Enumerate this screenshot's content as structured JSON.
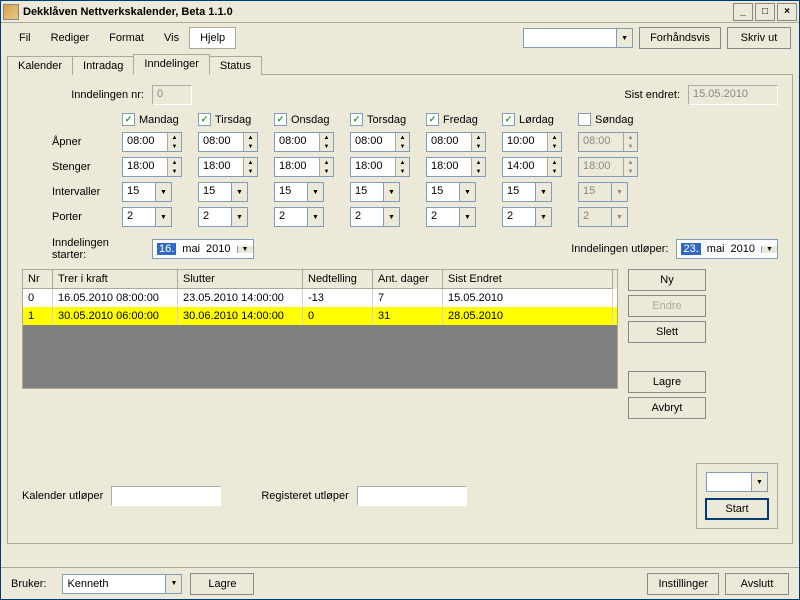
{
  "window": {
    "title": "Dekklåven Nettverkskalender, Beta 1.1.0"
  },
  "menu": {
    "fil": "Fil",
    "rediger": "Rediger",
    "format": "Format",
    "vis": "Vis",
    "hjelp": "Hjelp"
  },
  "topbar": {
    "preview": "Forhåndsvis",
    "print": "Skriv ut"
  },
  "tabs": {
    "kalender": "Kalender",
    "intradag": "Intradag",
    "inndelinger": "Inndelinger",
    "status": "Status"
  },
  "form": {
    "inndnr_lbl": "Inndelingen nr:",
    "inndnr_val": "0",
    "sistendret_lbl": "Sist endret:",
    "sistendret_val": "15.05.2010",
    "days": {
      "mon": "Mandag",
      "tue": "Tirsdag",
      "wed": "Onsdag",
      "thu": "Torsdag",
      "fri": "Fredag",
      "sat": "Lørdag",
      "sun": "Søndag"
    },
    "checked": {
      "mon": true,
      "tue": true,
      "wed": true,
      "thu": true,
      "fri": true,
      "sat": true,
      "sun": false
    },
    "rowlabels": {
      "apner": "Åpner",
      "stenger": "Stenger",
      "intervaller": "Intervaller",
      "porter": "Porter"
    },
    "apner": {
      "mon": "08:00",
      "tue": "08:00",
      "wed": "08:00",
      "thu": "08:00",
      "fri": "08:00",
      "sat": "10:00",
      "sun": "08:00"
    },
    "stenger": {
      "mon": "18:00",
      "tue": "18:00",
      "wed": "18:00",
      "thu": "18:00",
      "fri": "18:00",
      "sat": "14:00",
      "sun": "18:00"
    },
    "intervaller": {
      "mon": "15",
      "tue": "15",
      "wed": "15",
      "thu": "15",
      "fri": "15",
      "sat": "15",
      "sun": "15"
    },
    "porter": {
      "mon": "2",
      "tue": "2",
      "wed": "2",
      "thu": "2",
      "fri": "2",
      "sat": "2",
      "sun": "2"
    },
    "start_lbl": "Inndelingen starter:",
    "start_d": "16.",
    "start_m": "mai",
    "start_y": "2010",
    "end_lbl": "Inndelingen utløper:",
    "end_d": "23.",
    "end_m": "mai",
    "end_y": "2010"
  },
  "table": {
    "headers": {
      "nr": "Nr",
      "trer": "Trer i kraft",
      "slutter": "Slutter",
      "ned": "Nedtelling",
      "ant": "Ant. dager",
      "sist": "Sist Endret"
    },
    "rows": [
      {
        "nr": "0",
        "trer": "16.05.2010 08:00:00",
        "slutter": "23.05.2010 14:00:00",
        "ned": "-13",
        "ant": "7",
        "sist": "15.05.2010"
      },
      {
        "nr": "1",
        "trer": "30.05.2010 06:00:00",
        "slutter": "30.06.2010 14:00:00",
        "ned": "0",
        "ant": "31",
        "sist": "28.05.2010"
      }
    ]
  },
  "buttons": {
    "ny": "Ny",
    "endre": "Endre",
    "slett": "Slett",
    "lagre": "Lagre",
    "avbryt": "Avbryt",
    "start": "Start"
  },
  "bottom": {
    "kal_lbl": "Kalender utløper",
    "reg_lbl": "Registeret utløper"
  },
  "status": {
    "bruker_lbl": "Bruker:",
    "bruker_val": "Kenneth",
    "lagre": "Lagre",
    "innst": "Instillinger",
    "avslutt": "Avslutt"
  }
}
